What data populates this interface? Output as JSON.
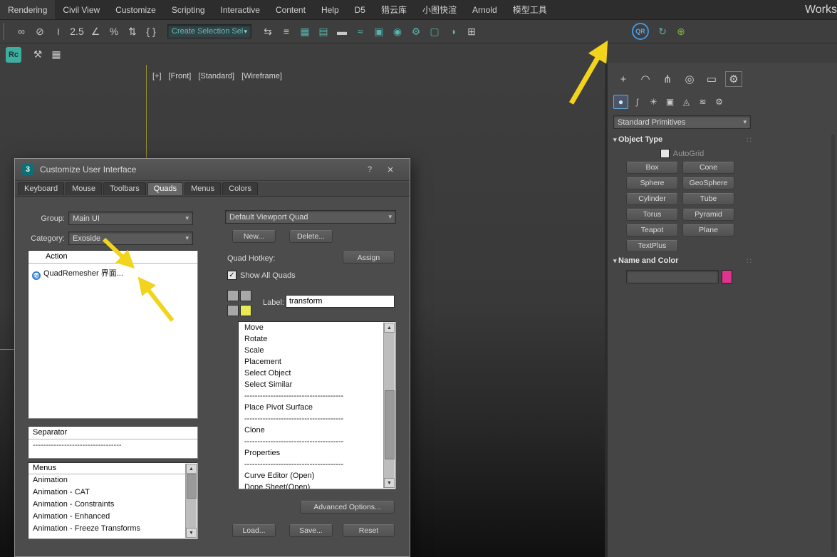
{
  "menubar": {
    "items": [
      "Rendering",
      "Civil View",
      "Customize",
      "Scripting",
      "Interactive",
      "Content",
      "Help",
      "D5",
      "猎云库",
      "小图快渲",
      "Arnold",
      "模型工具"
    ],
    "workspaces_label": "Works"
  },
  "toolbar_main": {
    "icons_left": [
      {
        "name": "select-and-link-icon",
        "glyph": "∞",
        "color": "#c8c8c8"
      },
      {
        "name": "unlink-selection-icon",
        "glyph": "⊘",
        "color": "#c8c8c8"
      },
      {
        "name": "bind-to-space-warp-icon",
        "glyph": "≀",
        "color": "#c8c8c8"
      },
      {
        "name": "snaps-toggle-icon",
        "glyph": "2.5",
        "color": "#c8c8c8"
      },
      {
        "name": "angle-snap-icon",
        "glyph": "∠",
        "color": "#c8c8c8"
      },
      {
        "name": "percent-snap-icon",
        "glyph": "%",
        "color": "#c8c8c8"
      },
      {
        "name": "spinner-snap-icon",
        "glyph": "⇅",
        "color": "#c8c8c8"
      },
      {
        "name": "edit-named-selection-sets-icon",
        "glyph": "{ }",
        "color": "#c8c8c8"
      }
    ],
    "selection_set_value": "Create Selection Sel",
    "icons_right": [
      {
        "name": "mirror-icon",
        "glyph": "⇆",
        "color": "#c8c8c8"
      },
      {
        "name": "align-icon",
        "glyph": "≡",
        "color": "#c8c8c8"
      },
      {
        "name": "scene-explorer-icon",
        "glyph": "▦",
        "color": "#58b2ac"
      },
      {
        "name": "layer-explorer-icon",
        "glyph": "▤",
        "color": "#58b2ac"
      },
      {
        "name": "ribbon-toggle-icon",
        "glyph": "▬",
        "color": "#c8c8c8"
      },
      {
        "name": "curve-editor-icon",
        "glyph": "≈",
        "color": "#58b2ac"
      },
      {
        "name": "schematic-view-icon",
        "glyph": "▣",
        "color": "#58b2ac"
      },
      {
        "name": "material-editor-icon",
        "glyph": "◉",
        "color": "#58b2ac"
      },
      {
        "name": "render-setup-icon",
        "glyph": "⚙",
        "color": "#58b2ac"
      },
      {
        "name": "rendered-frame-window-icon",
        "glyph": "▢",
        "color": "#58b2ac"
      },
      {
        "name": "render-production-icon",
        "glyph": "◑",
        "color": "#58b2ac"
      },
      {
        "name": "state-sets-icon",
        "glyph": "⊞",
        "color": "#c8c8c8"
      }
    ],
    "icons_plugin": [
      {
        "name": "quadremesher-update-icon",
        "glyph": "↻",
        "color": "#58b2ac"
      },
      {
        "name": "quadremesher-settings-icon",
        "glyph": "⊕",
        "color": "#7cb342"
      }
    ],
    "qr_label": "QR"
  },
  "toolbar_secondary": {
    "rc_label": "Rc",
    "icons": [
      {
        "name": "scene-converter-icon",
        "glyph": "⚒",
        "color": "#c8c8c8"
      },
      {
        "name": "spreadsheet-view-icon",
        "glyph": "▦",
        "color": "#c8c8c8"
      }
    ]
  },
  "viewport": {
    "labels": [
      "[+]",
      "[Front]",
      "[Standard]",
      "[Wireframe]"
    ]
  },
  "command_panel": {
    "tabs": [
      {
        "name": "create-tab-icon",
        "glyph": "+"
      },
      {
        "name": "modify-tab-icon",
        "glyph": "◠"
      },
      {
        "name": "hierarchy-tab-icon",
        "glyph": "⋔"
      },
      {
        "name": "motion-tab-icon",
        "glyph": "◎"
      },
      {
        "name": "display-tab-icon",
        "glyph": "▭"
      },
      {
        "name": "utilities-tab-icon",
        "glyph": "⚙"
      }
    ],
    "categories": [
      {
        "name": "geometry-category-icon",
        "glyph": "●"
      },
      {
        "name": "shapes-category-icon",
        "glyph": "ʃ"
      },
      {
        "name": "lights-category-icon",
        "glyph": "☀"
      },
      {
        "name": "cameras-category-icon",
        "glyph": "▣"
      },
      {
        "name": "helpers-category-icon",
        "glyph": "◬"
      },
      {
        "name": "space-warps-category-icon",
        "glyph": "≋"
      },
      {
        "name": "systems-category-icon",
        "glyph": "⚙"
      }
    ],
    "primitives_dropdown": "Standard Primitives",
    "object_type": {
      "title": "Object Type",
      "autogrid_label": "AutoGrid",
      "buttons": [
        "Box",
        "Cone",
        "Sphere",
        "GeoSphere",
        "Cylinder",
        "Tube",
        "Torus",
        "Pyramid",
        "Teapot",
        "Plane",
        "TextPlus"
      ]
    },
    "name_color": {
      "title": "Name and Color",
      "swatch_color": "#e0338f"
    }
  },
  "dialog": {
    "title": "Customize User Interface",
    "help_glyph": "?",
    "close_glyph": "×",
    "logo_glyph": "3",
    "tabs": [
      "Keyboard",
      "Mouse",
      "Toolbars",
      "Quads",
      "Menus",
      "Colors"
    ],
    "active_tab": "Quads",
    "group_label": "Group:",
    "group_value": "Main UI",
    "category_label": "Category:",
    "category_value": "Exoside",
    "action_list": {
      "header": "Action",
      "item_icon": "QR",
      "item_label": "QuadRemesher 界面..."
    },
    "separator_list": {
      "header": "Separator",
      "dashes": "----------------------------------"
    },
    "menus_list": {
      "header": "Menus",
      "items": [
        "Animation",
        "Animation - CAT",
        "Animation - Constraints",
        "Animation - Enhanced",
        "Animation - Freeze Transforms"
      ]
    },
    "right": {
      "quad_dropdown": "Default Viewport Quad",
      "new_label": "New...",
      "delete_label": "Delete...",
      "hotkey_label": "Quad Hotkey:",
      "assign_label": "Assign",
      "show_all_label": "Show All Quads",
      "label_label": "Label:",
      "label_value": "transform",
      "quad_colors": [
        "#a8a8a8",
        "#a8a8a8",
        "#a8a8a8",
        "#eaea55"
      ],
      "menu_items": [
        "Move",
        "Rotate",
        "Scale",
        "Placement",
        "Select Object",
        "Select Similar",
        "--------------------------------------",
        "Place Pivot Surface",
        "--------------------------------------",
        "Clone",
        "--------------------------------------",
        "Properties",
        "--------------------------------------",
        "Curve Editor (Open)",
        "Dope Sheet(Open)"
      ],
      "advanced_label": "Advanced Options...",
      "load_label": "Load...",
      "save_label": "Save...",
      "reset_label": "Reset"
    }
  },
  "annotations": {
    "arrow_color": "#f2d41d"
  }
}
